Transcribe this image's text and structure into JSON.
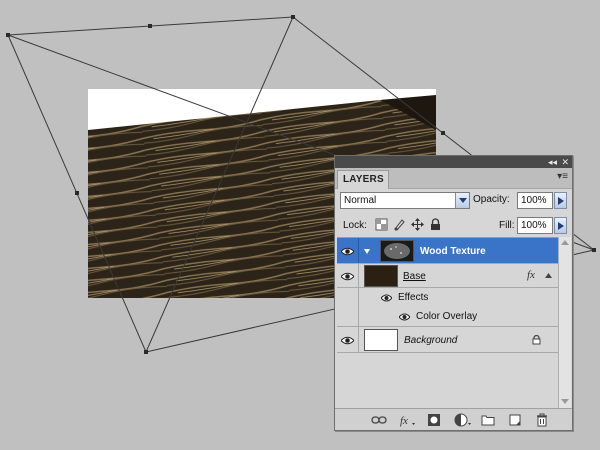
{
  "panel": {
    "title": "LAYERS",
    "collapse_glyph": "◂◂",
    "close_glyph": "✕",
    "menu_glyph": "▾≡"
  },
  "blend": {
    "mode": "Normal",
    "opacity_label": "Opacity:",
    "opacity_value": "100%"
  },
  "lock": {
    "label": "Lock:",
    "fill_label": "Fill:",
    "fill_value": "100%"
  },
  "layers": [
    {
      "name": "Wood Texture",
      "selected": true,
      "visible": true,
      "has_mask": true
    },
    {
      "name": "Base",
      "selected": false,
      "visible": true,
      "fx_badge": "fx"
    },
    {
      "name": "Effects",
      "sub": true
    },
    {
      "name": "Color Overlay",
      "sub": true,
      "effect": true
    },
    {
      "name": "Background",
      "selected": false,
      "visible": true,
      "locked": true
    }
  ],
  "colors": {
    "selection": "#3a74c9",
    "canvas_bg": "#c0c0c0",
    "wood_dark": "#2a2216",
    "wood_light": "#a08a62"
  },
  "icons": {
    "bottom_bar": [
      "link-icon",
      "fx-icon",
      "mask-icon",
      "adjustment-icon",
      "folder-icon",
      "new-layer-icon",
      "trash-icon"
    ]
  }
}
